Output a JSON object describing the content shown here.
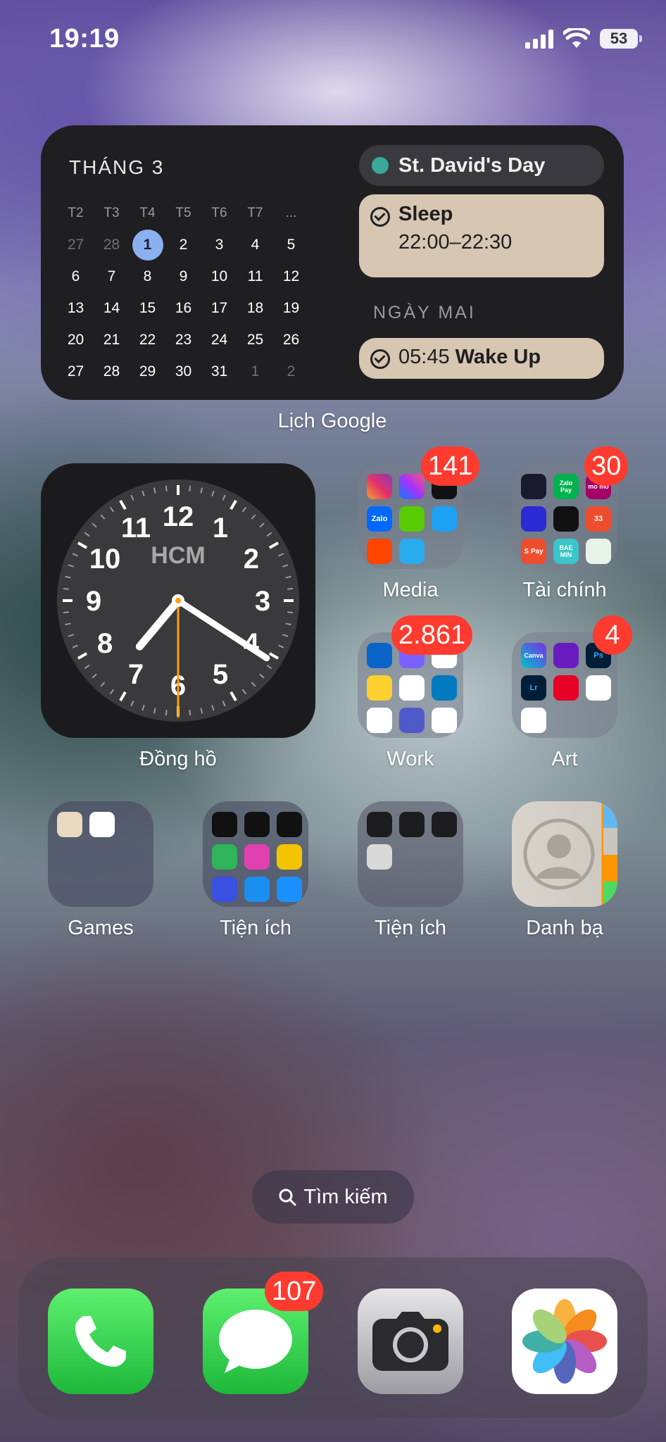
{
  "status_bar": {
    "time": "19:19",
    "battery": "53"
  },
  "calendar_widget": {
    "month": "THÁNG 3",
    "weekdays": [
      "T2",
      "T3",
      "T4",
      "T5",
      "T6",
      "T7",
      "..."
    ],
    "weeks": [
      [
        "27",
        "28",
        "1",
        "2",
        "3",
        "4",
        "5"
      ],
      [
        "6",
        "7",
        "8",
        "9",
        "10",
        "11",
        "12"
      ],
      [
        "13",
        "14",
        "15",
        "16",
        "17",
        "18",
        "19"
      ],
      [
        "20",
        "21",
        "22",
        "23",
        "24",
        "25",
        "26"
      ],
      [
        "27",
        "28",
        "29",
        "30",
        "31",
        "1",
        "2"
      ]
    ],
    "events": {
      "allday": "St. David's Day",
      "sleep_title": "Sleep",
      "sleep_time": "22:00–22:30",
      "tomorrow_label": "NGÀY MAI",
      "wake_time": "05:45",
      "wake_title": "Wake Up"
    },
    "label": "Lịch Google"
  },
  "clock_widget": {
    "city": "HCM",
    "label": "Đồng hồ",
    "numbers": [
      "12",
      "1",
      "2",
      "3",
      "4",
      "5",
      "6",
      "7",
      "8",
      "9",
      "10",
      "11"
    ],
    "hour": 19,
    "minute": 20,
    "second": 30
  },
  "folders": {
    "media": {
      "label": "Media",
      "badge": "141",
      "mini_labels": {
        "zalo": "Zalo"
      }
    },
    "finance": {
      "label": "Tài chính",
      "badge": "30",
      "mini_labels": {
        "zalopay": "Zalo Pay",
        "momo": "mo mo",
        "shopeepay": "S Pay",
        "baemin": "BAE MIN",
        "badge33": "33"
      }
    },
    "work": {
      "label": "Work",
      "badge": "2.861"
    },
    "art": {
      "label": "Art",
      "badge": "4",
      "mini_labels": {
        "canva": "Canva",
        "lightroom": "Lr",
        "photoshop": "Ps"
      }
    },
    "games": {
      "label": "Games"
    },
    "utilities1": {
      "label": "Tiện ích"
    },
    "utilities2": {
      "label": "Tiện ích"
    }
  },
  "apps": {
    "contacts": {
      "label": "Danh bạ"
    },
    "messages_badge": "107"
  },
  "search": {
    "label": "Tìm kiếm"
  },
  "colors": {
    "badge": "#ff3b30",
    "today": "#8ab0f0",
    "event_bg": "#d6c6b2",
    "widget_bg": "#1f1f22"
  }
}
